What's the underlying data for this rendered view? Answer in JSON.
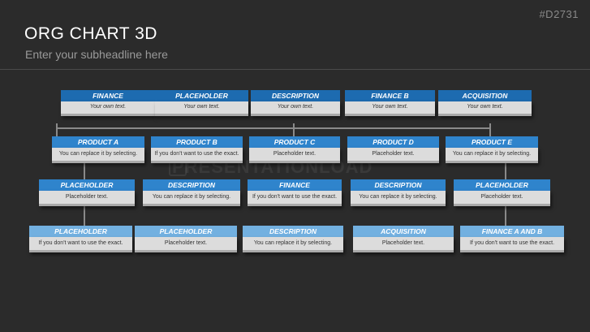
{
  "slide_code": "#D2731",
  "title": "ORG CHART 3D",
  "subtitle": "Enter your subheadline here",
  "watermark": "PRESENTATIONLOAD",
  "rows": [
    [
      {
        "head": "FINANCE",
        "text": "Your own text."
      },
      {
        "head": "PLACEHOLDER",
        "text": "Your own text."
      },
      {
        "head": "DESCRIPTION",
        "text": "Your own text."
      },
      {
        "head": "FINANCE B",
        "text": "Your own text."
      },
      {
        "head": "ACQUISITION",
        "text": "Your own text."
      }
    ],
    [
      {
        "head": "PRODUCT A",
        "text": "You can replace it by selecting."
      },
      {
        "head": "PRODUCT B",
        "text": "If you don't want to use the exact."
      },
      {
        "head": "PRODUCT C",
        "text": "Placeholder text."
      },
      {
        "head": "PRODUCT D",
        "text": "Placeholder text."
      },
      {
        "head": "PRODUCT E",
        "text": "You can replace it by selecting."
      }
    ],
    [
      {
        "head": "PLACEHOLDER",
        "text": "Placeholder text."
      },
      {
        "head": "DESCRIPTION",
        "text": "You can replace it by selecting."
      },
      {
        "head": "FINANCE",
        "text": "If you don't want to use the exact."
      },
      {
        "head": "DESCRIPTION",
        "text": "You can replace it by selecting."
      },
      {
        "head": "PLACEHOLDER",
        "text": "Placeholder text."
      }
    ],
    [
      {
        "head": "PLACEHOLDER",
        "text": "If you don't want to use the exact."
      },
      {
        "head": "PLACEHOLDER",
        "text": "Placeholder text."
      },
      {
        "head": "DESCRIPTION",
        "text": "You can replace it by selecting."
      },
      {
        "head": "ACQUISITION",
        "text": "Placeholder text."
      },
      {
        "head": "FINANCE A AND B",
        "text": "If you don't want to use the exact."
      }
    ]
  ]
}
